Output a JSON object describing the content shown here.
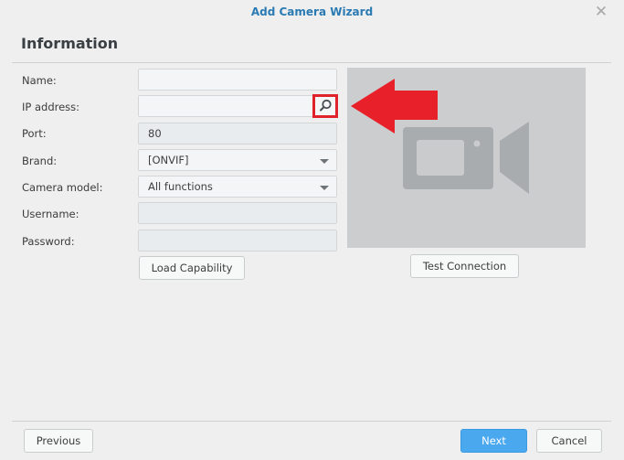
{
  "window": {
    "title": "Add Camera Wizard",
    "close_icon": "close-x-icon"
  },
  "section": {
    "title": "Information"
  },
  "form": {
    "name": {
      "label": "Name:",
      "value": ""
    },
    "ip_address": {
      "label": "IP address:",
      "value": "",
      "search_icon": "magnifier-icon"
    },
    "port": {
      "label": "Port:",
      "value": "80"
    },
    "brand": {
      "label": "Brand:",
      "value": "[ONVIF]"
    },
    "camera_model": {
      "label": "Camera model:",
      "value": "All functions"
    },
    "username": {
      "label": "Username:",
      "value": ""
    },
    "password": {
      "label": "Password:",
      "value": ""
    },
    "load_capability_label": "Load Capability"
  },
  "preview": {
    "icon": "video-camera-icon",
    "test_connection_label": "Test Connection"
  },
  "annotation": {
    "arrow_color": "#e8202a",
    "highlight_color": "#e0232b"
  },
  "footer": {
    "previous_label": "Previous",
    "next_label": "Next",
    "cancel_label": "Cancel"
  },
  "colors": {
    "accent": "#4aa8ef",
    "title": "#2a7ab3"
  }
}
